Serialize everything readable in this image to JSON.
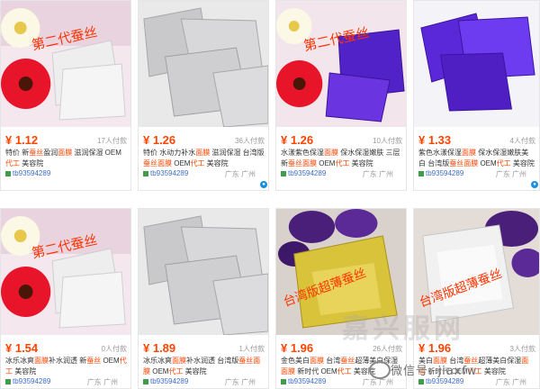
{
  "products": [
    {
      "price": "¥ 1.12",
      "sold": "17人付款",
      "title_parts": [
        "特价 新",
        "蚕丝",
        "盈润",
        "面膜",
        " 滋润保湿 OEM",
        "代工",
        " 美容院"
      ],
      "highlight_idx": [
        1,
        3,
        5
      ],
      "shop": "tb93594289",
      "location": "",
      "overlay_text": "第二代蚕丝",
      "image": "silk-mask-white-packs-flowers"
    },
    {
      "price": "¥ 1.26",
      "sold": "36人付款",
      "title_parts": [
        "特价 水动力补水",
        "面膜",
        " 滋润保湿 台湾版",
        "蚕丝",
        "面膜",
        " OEM",
        "代工",
        " 美容院"
      ],
      "highlight_idx": [
        1,
        3,
        4,
        6
      ],
      "shop": "tb93594289",
      "location": "广东 广州",
      "overlay_text": "",
      "image": "silver-foil-packs"
    },
    {
      "price": "¥ 1.26",
      "sold": "10人付款",
      "title_parts": [
        "水漾紫色保湿",
        "面膜",
        " 保水保湿嫩肤 三层新",
        "蚕",
        "丝",
        "面膜",
        " OEM",
        "代工",
        " 美容院"
      ],
      "highlight_idx": [
        1,
        3,
        4,
        5,
        7
      ],
      "shop": "tb93594289",
      "location": "广东 广州",
      "overlay_text": "第二代蚕丝",
      "image": "purple-packs-flowers"
    },
    {
      "price": "¥ 1.33",
      "sold": "4人付款",
      "title_parts": [
        "紫色水漾保湿",
        "面膜",
        " 保水保湿嫩肤美白 台湾版",
        "蚕丝",
        "面膜",
        " OEM",
        "代工",
        " 美容院"
      ],
      "highlight_idx": [
        1,
        3,
        4,
        6
      ],
      "shop": "tb93594289",
      "location": "广东 广州",
      "overlay_text": "",
      "image": "purple-foil-packs"
    },
    {
      "price": "¥ 1.54",
      "sold": "0人付款",
      "title_parts": [
        "冰乐冰爽",
        "面膜",
        "补水润透 新",
        "蚕丝",
        " OEM",
        "代工",
        " 美容院"
      ],
      "highlight_idx": [
        1,
        3,
        5
      ],
      "shop": "tb93594289",
      "location": "广东 广州",
      "overlay_text": "第二代蚕丝",
      "image": "silk-mask-white-packs-flowers"
    },
    {
      "price": "¥ 1.89",
      "sold": "1人付款",
      "title_parts": [
        "冰乐冰爽",
        "面膜",
        "补水润透 台湾版",
        "蚕丝",
        "面膜",
        " OEM",
        "代工",
        " 美容院"
      ],
      "highlight_idx": [
        1,
        3,
        4,
        6
      ],
      "shop": "tb93594289",
      "location": "广东 广州",
      "overlay_text": "",
      "image": "silver-foil-packs"
    },
    {
      "price": "¥ 1.96",
      "sold": "26人付款",
      "title_parts": [
        "金色美白",
        "面膜",
        " 台湾",
        "蚕丝",
        "超薄美白保湿",
        "面膜",
        " 新时代 OEM",
        "代工",
        " 美容院"
      ],
      "highlight_idx": [
        1,
        3,
        5,
        7
      ],
      "shop": "tb93594289",
      "location": "广东 广州",
      "overlay_text": "台湾版超薄蚕丝",
      "image": "gold-packs-purple-flowers"
    },
    {
      "price": "¥ 1.96",
      "sold": "3人付款",
      "title_parts": [
        "美白",
        "面膜",
        " 台湾",
        "蚕丝",
        "超薄美白保湿",
        "面膜",
        " 新时代 OEM",
        "代工",
        " 美容院"
      ],
      "highlight_idx": [
        1,
        3,
        5,
        7
      ],
      "shop": "tb93594289",
      "location": "广东 广州",
      "overlay_text": "台湾版超薄蚕丝",
      "image": "white-packs-purple-flowers"
    }
  ],
  "watermark": {
    "text": "微信号: jiaxfw",
    "faded_text": "嘉兴服网"
  },
  "colors": {
    "price": "#ff4400",
    "highlight": "#ff4400",
    "shop_link": "#3d6dcc",
    "overlay": "#ff3300",
    "border": "#e6e6e6"
  }
}
